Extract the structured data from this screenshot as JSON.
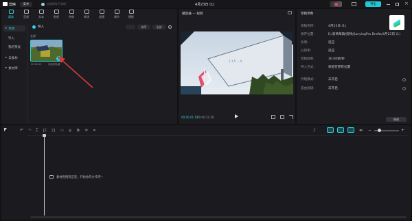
{
  "app": {
    "name": "剪映",
    "menu_label": "菜单",
    "autosave": "自动保存于本地 ·",
    "title": "4月23日 (1)",
    "export_label": "导出"
  },
  "toolbar": [
    {
      "label": "媒体",
      "icon": "media-icon"
    },
    {
      "label": "音频",
      "icon": "audio-icon"
    },
    {
      "label": "文本",
      "icon": "text-icon"
    },
    {
      "label": "贴纸",
      "icon": "sticker-icon"
    },
    {
      "label": "特效",
      "icon": "effects-icon"
    },
    {
      "label": "转场",
      "icon": "transition-icon"
    },
    {
      "label": "滤镜",
      "icon": "filter-icon"
    },
    {
      "label": "调节",
      "icon": "adjust-icon"
    },
    {
      "label": "模板",
      "icon": "template-icon"
    }
  ],
  "sidebar": {
    "items": [
      "本地",
      "导入",
      "我的预设",
      "云素材",
      "素材库"
    ]
  },
  "media": {
    "import_label": "导入",
    "section_label": "全部",
    "sort_label": "排序",
    "filter_label": "全部",
    "clip_caption": "添加到轨道",
    "clip_duration": "00:00:12"
  },
  "player": {
    "title": "播放器 — 视频",
    "time_current": "00:00:01:15",
    "time_total": "00:00:12:28"
  },
  "properties": {
    "title": "草稿参数",
    "rows": [
      {
        "label": "草稿名称:",
        "value": "4月23日 (1)"
      },
      {
        "label": "保存位置:",
        "value": "E:/剪映草稿/剪映/JianyingPro Drafts/4月23日 (1)"
      },
      {
        "label": "比例:",
        "value": "适应"
      },
      {
        "label": "分辨率:",
        "value": "适应"
      },
      {
        "label": "草稿帧率:",
        "value": "30.00帧/秒"
      },
      {
        "label": "导入方式:",
        "value": "保留在原有位置"
      },
      {
        "label": "代理模式:",
        "value": "未开启"
      },
      {
        "label": "自由层级:",
        "value": "未开启"
      }
    ],
    "edit_label": "修改"
  },
  "timeline": {
    "hint": "素材拖拽到这里，开始你的大作吧~"
  },
  "colors": {
    "accent": "#2bd4e0",
    "bg": "#121215",
    "panel": "#1d1d21",
    "arrow": "#d93a3a"
  }
}
